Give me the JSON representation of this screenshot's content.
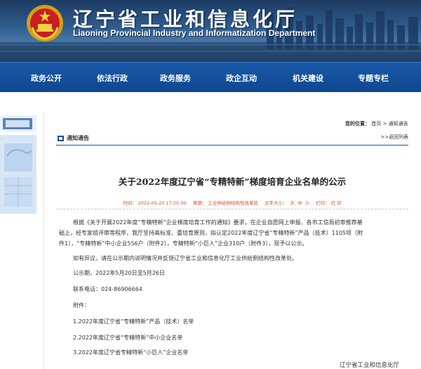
{
  "header": {
    "title_cn": "辽宁省工业和信息化厅",
    "title_en": "Liaoning Provincial Industry and Informatization Department"
  },
  "nav": {
    "items": [
      {
        "label": "政务公开"
      },
      {
        "label": "依法行政"
      },
      {
        "label": "政务服务"
      },
      {
        "label": "政企互动"
      },
      {
        "label": "机关建设"
      },
      {
        "label": "专题专栏"
      }
    ]
  },
  "breadcrumb": {
    "label": "您的位置：",
    "home": "首页",
    "separator": ">",
    "current": "通知通告"
  },
  "section": {
    "title": "通知通告",
    "back_link": ">>返回列表"
  },
  "article": {
    "title": "关于2022年度辽宁省“专精特新”梯度培育企业名单的公示",
    "meta": {
      "time_label": "时间：",
      "time": "2022-05-20 17:05:00",
      "source_label": "来源：",
      "source": "工业供给侧结构性改革处",
      "font_label": "文字大小：",
      "font_large": "大",
      "font_medium": "中",
      "font_small": "小",
      "print_label": "打印：",
      "print": "打 印"
    },
    "body": [
      "根据《关于开展2022年度“专精特新”企业梯度培育工作的通知》要求，在企业自愿网上申报、各市工信局初审推荐基",
      "础上，经专家组评审等程序，我厅坚持高标准、重培育原则，拟认定2022年度辽宁省“专精特新”产品（技术）1105项（附",
      "件1），“专精特新”中小企业556户（附件2），专精特新“小巨人”企业310户（附件3），现予以公示。",
      "如有异议，请在公示期内说明情况并反馈辽宁省工业和信息化厅工业供给侧结构性改革处。",
      "公示期，2022年5月20日至5月26日",
      "联系电话：024-86906664",
      "附件：",
      "1.2022年度辽宁省“专精特新”产品（技术）名单",
      "2.2022年度辽宁省“专精特新”中小企业名单",
      "3.2022年度辽宁省专精特新“小巨人”企业名单"
    ],
    "signature": "辽宁省工业和信息化厅"
  },
  "colors": {
    "nav_bg": "#0f4690",
    "accent_red": "#d84b2b",
    "section_line": "#1a4e92"
  }
}
